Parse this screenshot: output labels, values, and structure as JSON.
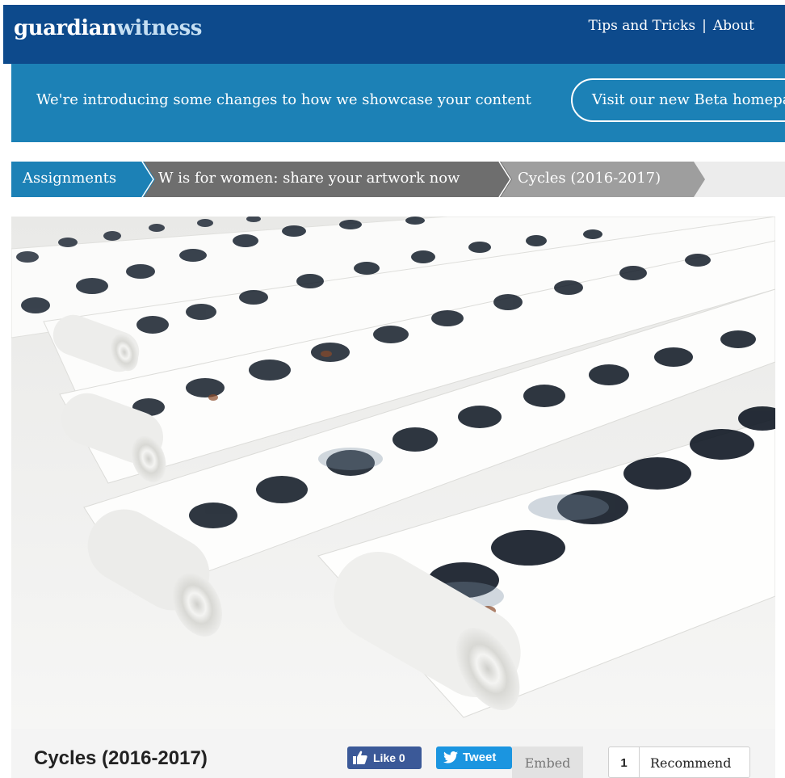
{
  "header": {
    "logo_part1": "guardian",
    "logo_part2": "witness",
    "nav": [
      {
        "label": "Tips and Tricks"
      },
      {
        "label": "About"
      }
    ],
    "nav_separator": "|"
  },
  "banner": {
    "text": "We're introducing some changes to how we showcase your content",
    "button_label": "Visit our new Beta homepage"
  },
  "breadcrumb": [
    {
      "label": "Assignments",
      "color": "#1c81b6"
    },
    {
      "label": "W is for women: share your artwork now",
      "color": "#6e6e6e"
    },
    {
      "label": "Cycles (2016-2017)",
      "color": "#9e9e9e"
    }
  ],
  "footer": {
    "title": "Cycles (2016-2017)",
    "like_label": "Like 0",
    "tweet_label": "Tweet",
    "embed_label": "Embed",
    "recommend_count": "1",
    "recommend_label": "Recommend"
  },
  "colors": {
    "header_bg": "#0d4a8c",
    "banner_bg": "#1c81b6",
    "facebook": "#3b5998",
    "twitter": "#1b95e0"
  }
}
